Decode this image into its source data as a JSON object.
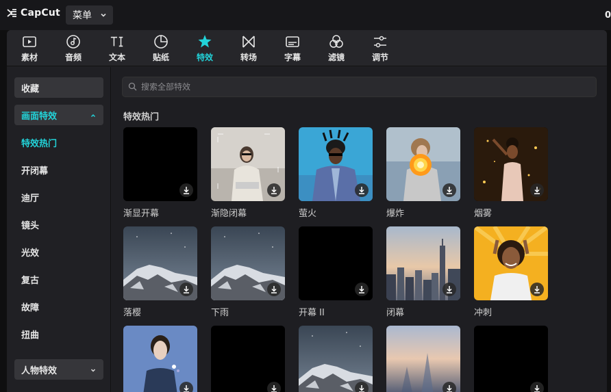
{
  "titlebar": {
    "app_name": "CapCut",
    "menu_label": "菜单",
    "right_text": "0"
  },
  "toolbar": {
    "items": [
      {
        "label": "素材",
        "icon": "media-icon"
      },
      {
        "label": "音频",
        "icon": "audio-icon"
      },
      {
        "label": "文本",
        "icon": "text-icon"
      },
      {
        "label": "贴纸",
        "icon": "sticker-icon"
      },
      {
        "label": "特效",
        "icon": "effects-icon"
      },
      {
        "label": "转场",
        "icon": "transition-icon"
      },
      {
        "label": "字幕",
        "icon": "caption-icon"
      },
      {
        "label": "滤镜",
        "icon": "filter-icon"
      },
      {
        "label": "调节",
        "icon": "adjust-icon"
      }
    ],
    "active_index": 4
  },
  "sidebar": {
    "favorites": "收藏",
    "category": "画面特效",
    "items": [
      "特效热门",
      "开闭幕",
      "迪厅",
      "镜头",
      "光效",
      "复古",
      "故障",
      "扭曲"
    ],
    "bottom_category": "人物特效"
  },
  "content": {
    "search_placeholder": "搜索全部特效",
    "section_title": "特效热门",
    "cards": [
      {
        "label": "渐显开幕",
        "thumb": "black"
      },
      {
        "label": "渐隐闭幕",
        "thumb": "woman-sitting"
      },
      {
        "label": "萤火",
        "thumb": "man-blue"
      },
      {
        "label": "爆炸",
        "thumb": "explosion"
      },
      {
        "label": "烟雾",
        "thumb": "dancer-sparkle"
      },
      {
        "label": "落樱",
        "thumb": "mountain"
      },
      {
        "label": "下雨",
        "thumb": "mountain"
      },
      {
        "label": "开幕 II",
        "thumb": "black"
      },
      {
        "label": "闭幕",
        "thumb": "city"
      },
      {
        "label": "冲刺",
        "thumb": "woman-yellow"
      },
      {
        "label": "",
        "thumb": "woman-blue"
      },
      {
        "label": "",
        "thumb": "black"
      },
      {
        "label": "",
        "thumb": "mountain"
      },
      {
        "label": "",
        "thumb": "blur-sky"
      },
      {
        "label": "",
        "thumb": "black"
      }
    ]
  },
  "colors": {
    "accent": "#22d3d9",
    "background": "#0f0f10",
    "panel": "#202024"
  }
}
